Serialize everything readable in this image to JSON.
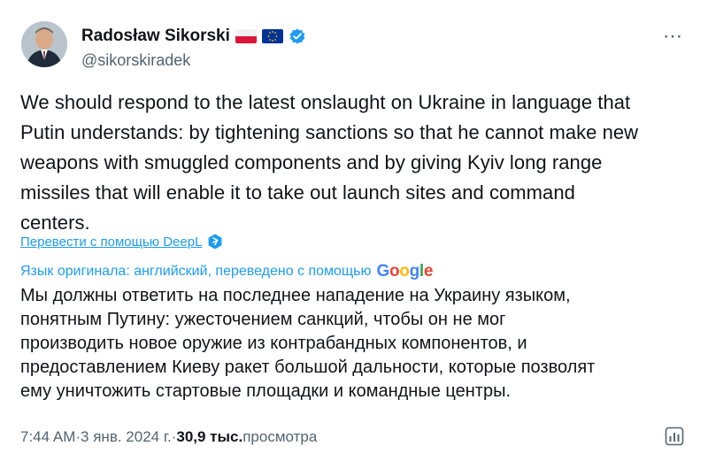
{
  "author": {
    "display_name": "Radosław Sikorski",
    "handle": "@sikorskiradek",
    "flags": [
      "poland-flag-icon",
      "eu-flag-icon"
    ],
    "verified_color": "#1d9bf0"
  },
  "more_icon": "⋯",
  "tweet": {
    "text": "We should respond to the latest onslaught on Ukraine in language that\nPutin understands: by tightening sanctions so that he cannot make new\nweapons with smuggled components and by giving Kyiv long range\nmissiles that will enable it to take out launch sites and command\ncenters."
  },
  "translation": {
    "link_label": "Перевести с помощью DeepL",
    "note": "Язык оригинала: английский, переведено с помощью",
    "provider": [
      "G",
      "o",
      "o",
      "g",
      "l",
      "e"
    ],
    "text": "Мы должны ответить на последнее нападение на Украину языком,\nпонятным Путину: ужесточением санкций, чтобы он не мог\nпроизводить новое оружие из контрабандных компонентов, и\nпредоставлением Киеву ракет большой дальности, которые позволят\nему уничтожить стартовые площадки и командные центры."
  },
  "meta": {
    "time": "7:44 AM",
    "sep1": " · ",
    "date": "3 янв. 2024 г.",
    "sep2": " · ",
    "views": "30,9 тыс.",
    "views_label": " просмотра"
  },
  "colors": {
    "accent": "#1d9bf0",
    "text": "#0f1419",
    "secondary": "#536471"
  }
}
